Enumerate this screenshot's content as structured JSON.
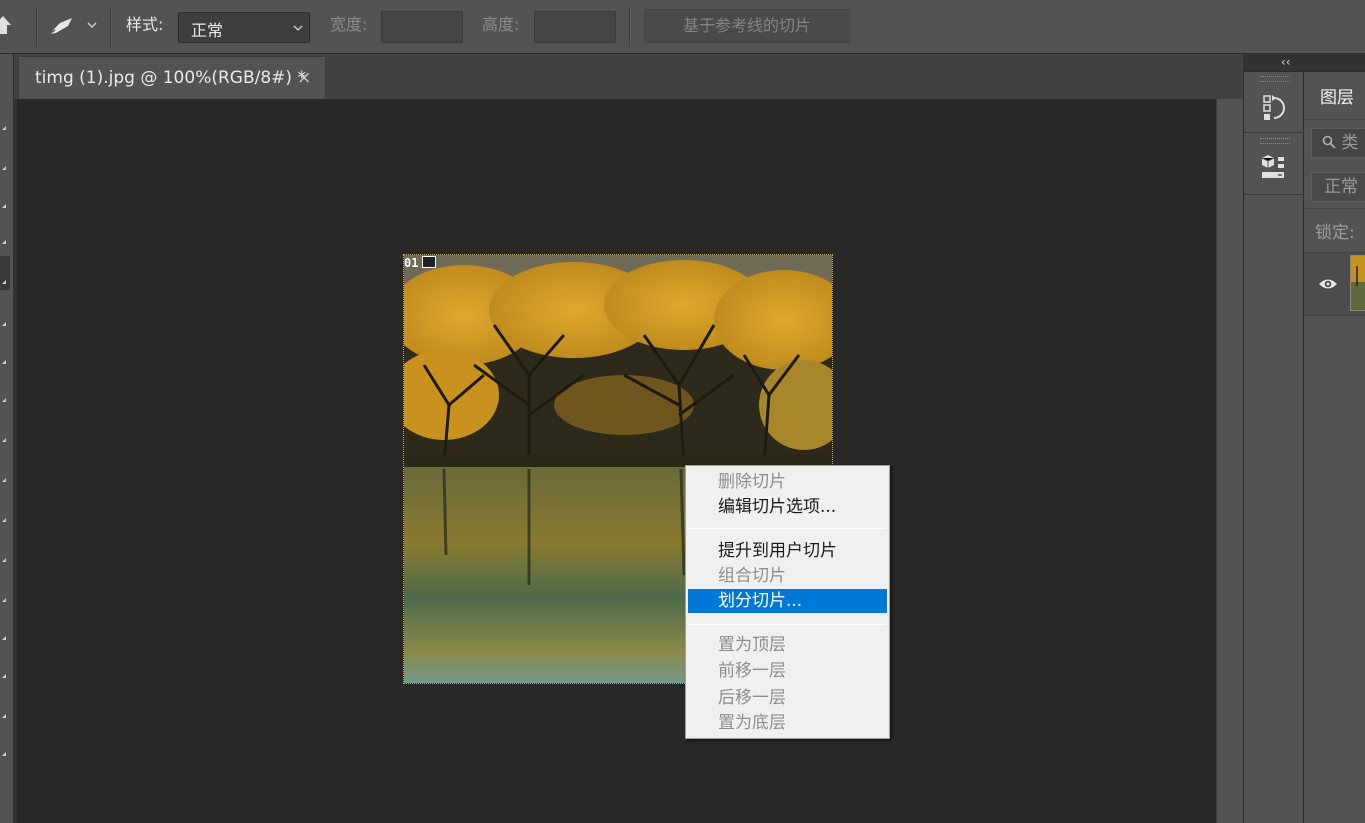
{
  "options_bar": {
    "style_label": "样式:",
    "style_value": "正常",
    "width_label": "宽度:",
    "width_value": "",
    "height_label": "高度:",
    "height_value": "",
    "guides_slices_button": "基于参考线的切片"
  },
  "document": {
    "tab_title": "timg (1).jpg @ 100%(RGB/8#) *",
    "close_glyph": "×",
    "slice_number": "01"
  },
  "context_menu": {
    "items": [
      {
        "label": "删除切片",
        "enabled": false
      },
      {
        "label": "编辑切片选项...",
        "enabled": true
      },
      {
        "label": "提升到用户切片",
        "enabled": true
      },
      {
        "label": "组合切片",
        "enabled": false
      },
      {
        "label": "划分切片...",
        "enabled": true,
        "highlighted": true
      },
      {
        "label": "置为顶层",
        "enabled": false
      },
      {
        "label": "前移一层",
        "enabled": false
      },
      {
        "label": "后移一层",
        "enabled": false
      },
      {
        "label": "置为底层",
        "enabled": false
      }
    ]
  },
  "right_dock": {
    "collapse_glyph": "‹‹",
    "layers_tab": "图层",
    "search_placeholder": "类",
    "blend_mode": "正常",
    "lock_label": "锁定:"
  },
  "icons": {
    "home": "home-icon",
    "slice_tool": "slice-tool-icon",
    "history": "history-panel-icon",
    "3d": "3d-panel-icon",
    "eye": "visibility-eye-icon"
  },
  "colors": {
    "menu_highlight": "#0078d7",
    "canvas_bg": "#282828",
    "panel_bg": "#535353"
  }
}
